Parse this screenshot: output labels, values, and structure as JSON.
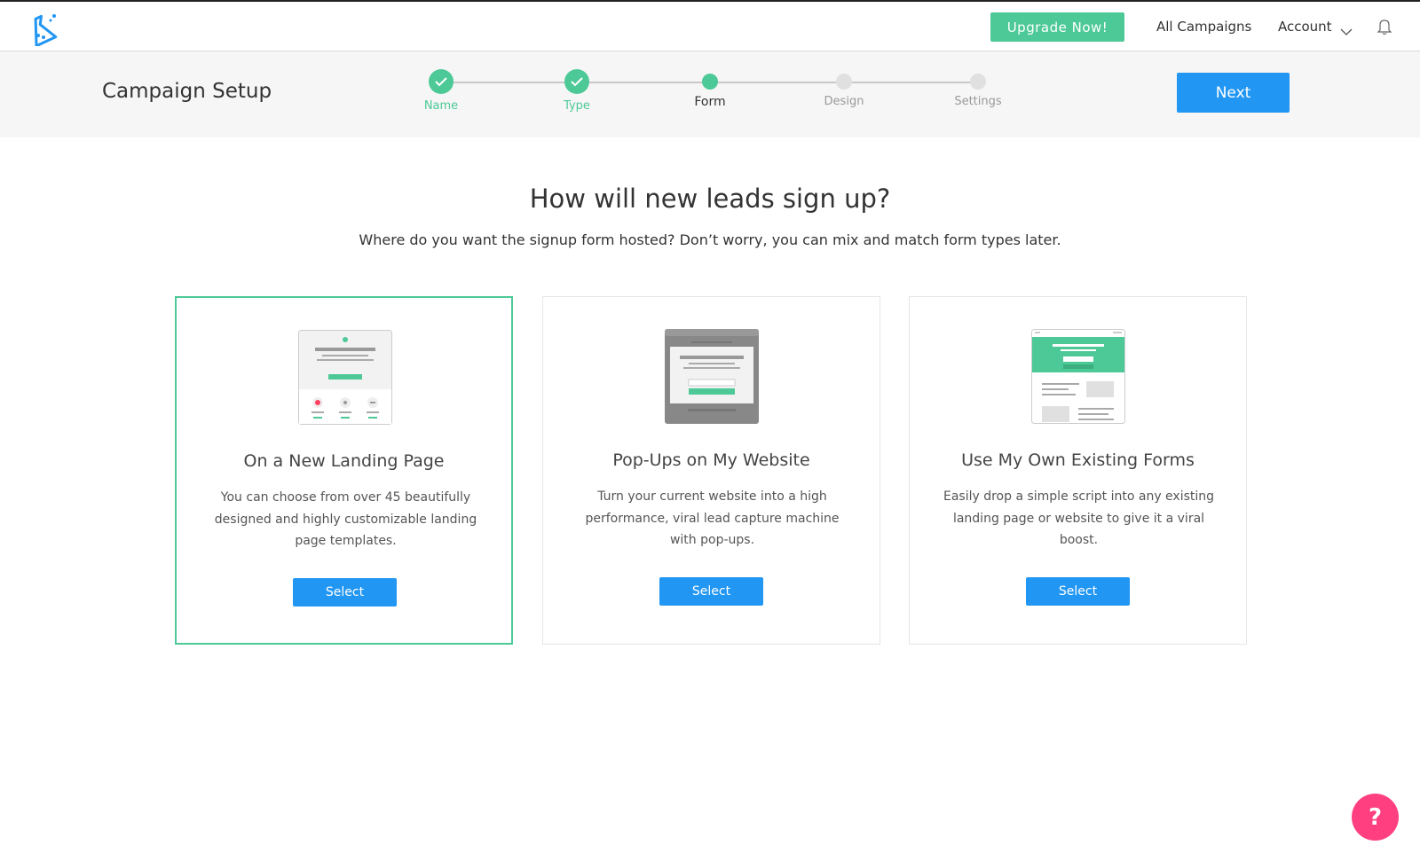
{
  "topbar": {
    "logo_icon": "flask-icon",
    "upgrade_label": "Upgrade Now!",
    "campaigns_label": "All Campaigns",
    "account_label": "Account",
    "bell_icon": "bell-icon"
  },
  "setup": {
    "title": "Campaign Setup",
    "next_label": "Next",
    "steps": [
      {
        "label": "Name",
        "state": "done"
      },
      {
        "label": "Type",
        "state": "done"
      },
      {
        "label": "Form",
        "state": "active"
      },
      {
        "label": "Design",
        "state": "todo"
      },
      {
        "label": "Settings",
        "state": "todo"
      }
    ]
  },
  "main": {
    "heading": "How will new leads sign up?",
    "subheading": "Where do you want the signup form hosted? Don’t worry, you can mix and match form types later.",
    "cards": [
      {
        "title": "On a New Landing Page",
        "description": "You can choose from over 45 beautifully designed and highly customizable landing page templates.",
        "button": "Select",
        "selected": true
      },
      {
        "title": "Pop-Ups on My Website",
        "description": "Turn your current website into a high performance, viral lead capture machine with pop-ups.",
        "button": "Select",
        "selected": false
      },
      {
        "title": "Use My Own Existing Forms",
        "description": "Easily drop a simple script into any existing landing page or website to give it a viral boost.",
        "button": "Select",
        "selected": false
      }
    ]
  },
  "help": {
    "label": "?"
  },
  "colors": {
    "accent_green": "#4dc997",
    "primary_blue": "#2196f3",
    "help_pink": "#ff3f7f"
  }
}
